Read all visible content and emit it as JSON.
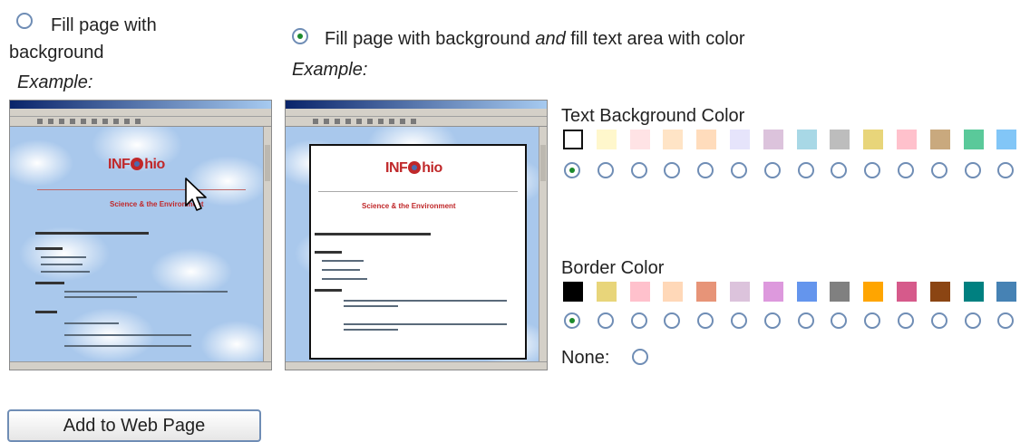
{
  "options": [
    {
      "label_line1": "Fill page with",
      "label_line2": "background",
      "example": "Example:",
      "selected": false
    },
    {
      "label_pre": "Fill page with background ",
      "label_em": "and",
      "label_post": " fill text area with color",
      "example": "Example:",
      "selected": true
    }
  ],
  "text_bg": {
    "title": "Text Background Color",
    "selected_index": 0,
    "colors": [
      "#ffffff",
      "#fff7cc",
      "#ffe3e5",
      "#ffe4c6",
      "#ffdcbc",
      "#e6e4fb",
      "#dcc3dc",
      "#a8d8e6",
      "#bdbdbd",
      "#e8d57a",
      "#ffc1cc",
      "#c9a97e",
      "#5ac99a",
      "#82c6f7"
    ]
  },
  "border": {
    "title": "Border Color",
    "selected_index": 0,
    "colors": [
      "#000000",
      "#e8d57a",
      "#ffc1cc",
      "#ffd8b8",
      "#e79478",
      "#dcc3dc",
      "#dd99dd",
      "#6495ed",
      "#808080",
      "#ffa500",
      "#d65a8b",
      "#8b4513",
      "#008080",
      "#4682b4"
    ],
    "none_label": "None:"
  },
  "preview": {
    "logo": "INF●hio",
    "heading": "Science & the Environment"
  },
  "button_label": "Add to Web Page"
}
